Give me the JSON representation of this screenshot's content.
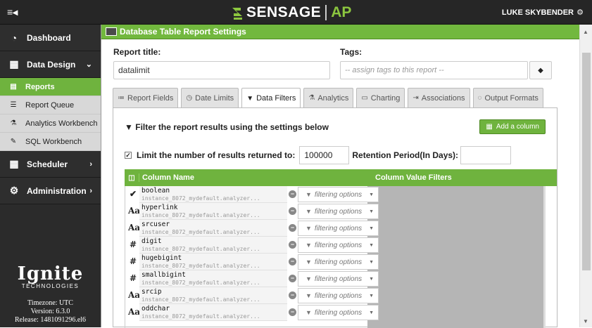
{
  "topbar": {
    "menu_icon": "≡◂",
    "logo_text": "SENSAGE",
    "logo_suffix": "AP",
    "user_name": "LUKE SKYBENDER",
    "settings_icon": "gear-icon"
  },
  "sidebar": {
    "main": [
      {
        "label": "Dashboard",
        "icon": "dashboard-icon"
      },
      {
        "label": "Data Design",
        "icon": "table-icon",
        "expanded": true
      },
      {
        "label": "Scheduler",
        "icon": "calendar-icon"
      },
      {
        "label": "Administration",
        "icon": "gears-icon"
      }
    ],
    "sub": [
      {
        "label": "Reports",
        "active": true
      },
      {
        "label": "Report Queue"
      },
      {
        "label": "Analytics Workbench"
      },
      {
        "label": "SQL Workbench"
      }
    ],
    "brand": {
      "name": "Ignite",
      "tagline": "TECHNOLOGIES"
    },
    "meta": {
      "timezone": "Timezone: UTC",
      "version": "Version: 6.3.0",
      "release": "Release: 1481091296.el6"
    }
  },
  "panel": {
    "title": "Database Table Report Settings"
  },
  "form": {
    "report_title_label": "Report title:",
    "report_title_value": "datalimit",
    "tags_label": "Tags:",
    "tags_placeholder": "-- assign tags to this report --"
  },
  "tabs": [
    {
      "label": "Report Fields",
      "icon": "≔"
    },
    {
      "label": "Date Limits",
      "icon": "◷"
    },
    {
      "label": "Data Filters",
      "icon": "▼",
      "active": true
    },
    {
      "label": "Analytics",
      "icon": "⚗"
    },
    {
      "label": "Charting",
      "icon": "▭"
    },
    {
      "label": "Associations",
      "icon": "⇥"
    },
    {
      "label": "Output Formats",
      "icon": "◌"
    }
  ],
  "filters": {
    "heading": "Filter the report results using the settings below",
    "add_column_label": "Add a column",
    "limit_label": "Limit the number of results returned to:",
    "limit_value": "100000",
    "limit_checked": true,
    "retention_label": "Retention Period(In Days):",
    "retention_value": ""
  },
  "grid": {
    "header_name": "Column Name",
    "header_filters": "Column Value Filters",
    "filter_placeholder": "filtering options",
    "rows": [
      {
        "type_icon": "✔",
        "name": "boolean",
        "source": "instance_8072_mydefault.analyzer..."
      },
      {
        "type_icon": "Aa",
        "name": "hyperlink",
        "source": "instance_8072_mydefault.analyzer..."
      },
      {
        "type_icon": "Aa",
        "name": "srcuser",
        "source": "instance_8072_mydefault.analyzer..."
      },
      {
        "type_icon": "#",
        "name": "digit",
        "source": "instance_8072_mydefault.analyzer..."
      },
      {
        "type_icon": "#",
        "name": "hugebigint",
        "source": "instance_8072_mydefault.analyzer..."
      },
      {
        "type_icon": "#",
        "name": "smallbigint",
        "source": "instance_8072_mydefault.analyzer..."
      },
      {
        "type_icon": "Aa",
        "name": "srcip",
        "source": "instance_8072_mydefault.analyzer..."
      },
      {
        "type_icon": "Aa",
        "name": "oddchar",
        "source": "instance_8072_mydefault.analyzer..."
      }
    ]
  },
  "colors": {
    "accent": "#6fb33e",
    "topbar": "#262626",
    "sidebar": "#2b2b2b"
  }
}
